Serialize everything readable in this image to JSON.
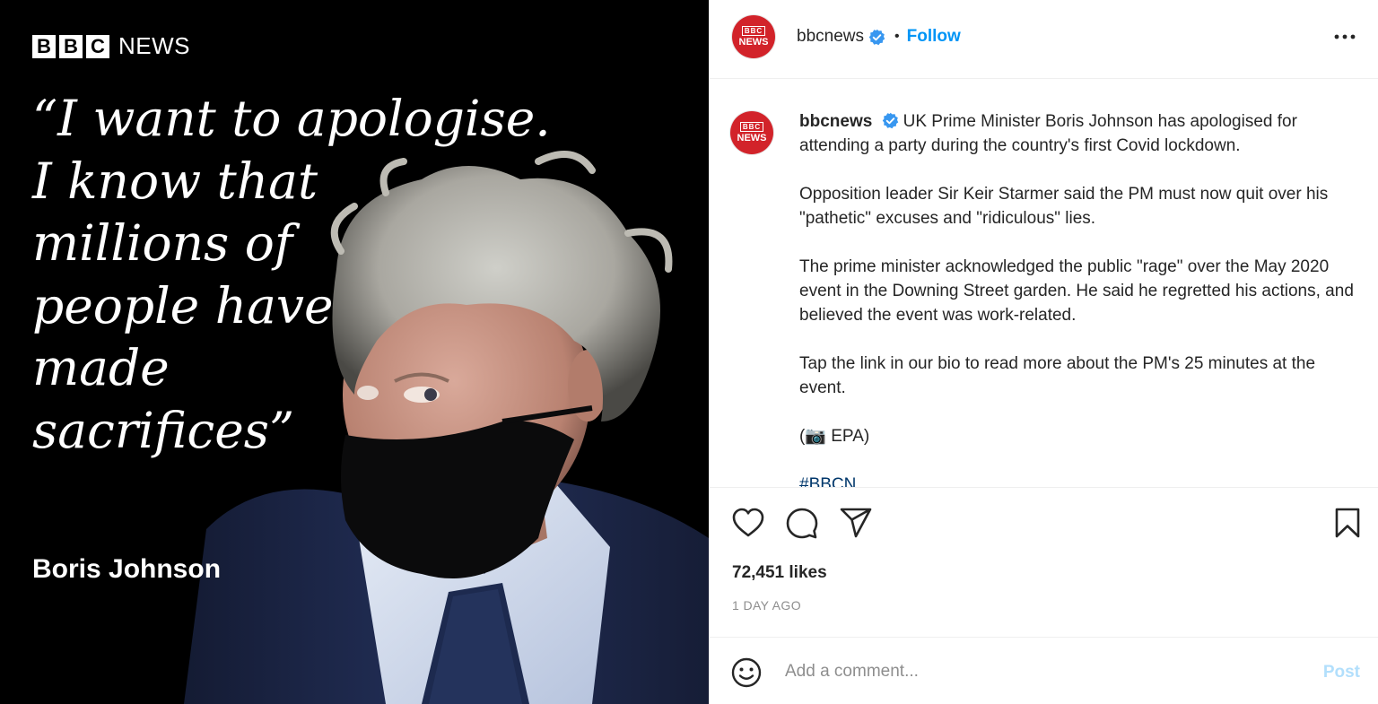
{
  "media": {
    "logo_letters": [
      "B",
      "B",
      "C"
    ],
    "logo_news": "NEWS",
    "quote_lines": [
      "“I want to apologise.",
      "I know that",
      "millions of",
      "people have",
      "made",
      "sacrifices”"
    ],
    "attribution": "Boris Johnson"
  },
  "header": {
    "avatar_top": "BBC",
    "avatar_bottom": "NEWS",
    "username": "bbcnews",
    "separator": "•",
    "follow_label": "Follow",
    "more_icon": "more-horizontal-icon"
  },
  "caption": {
    "avatar_top": "BBC",
    "avatar_bottom": "NEWS",
    "username": "bbcnews",
    "paragraph_1": "UK Prime Minister Boris Johnson has apologised for attending a party during the country's first Covid lockdown.",
    "paragraph_2": "Opposition leader Sir Keir Starmer said the PM must now quit over his \"pathetic\" excuses and \"ridiculous\" lies.",
    "paragraph_3": "The prime minister acknowledged the public \"rage\" over the May 2020 event in the Downing Street garden. He said he regretted his actions, and believed the event was work-related.",
    "paragraph_4": "Tap the link in our bio to read more about the PM's 25 minutes at the event.",
    "credit": "(📷 EPA)",
    "hashtag": "#BBCN"
  },
  "actions": {
    "icons": [
      "heart-icon",
      "comment-icon",
      "share-icon",
      "bookmark-icon"
    ],
    "likes": "72,451 likes",
    "timestamp": "1 DAY AGO"
  },
  "comment": {
    "placeholder": "Add a comment...",
    "post_label": "Post"
  },
  "colors": {
    "accent": "#0095f6",
    "post_disabled": "#b2dffc",
    "bbc_red": "#d2232a",
    "verified": "#3897f0"
  }
}
